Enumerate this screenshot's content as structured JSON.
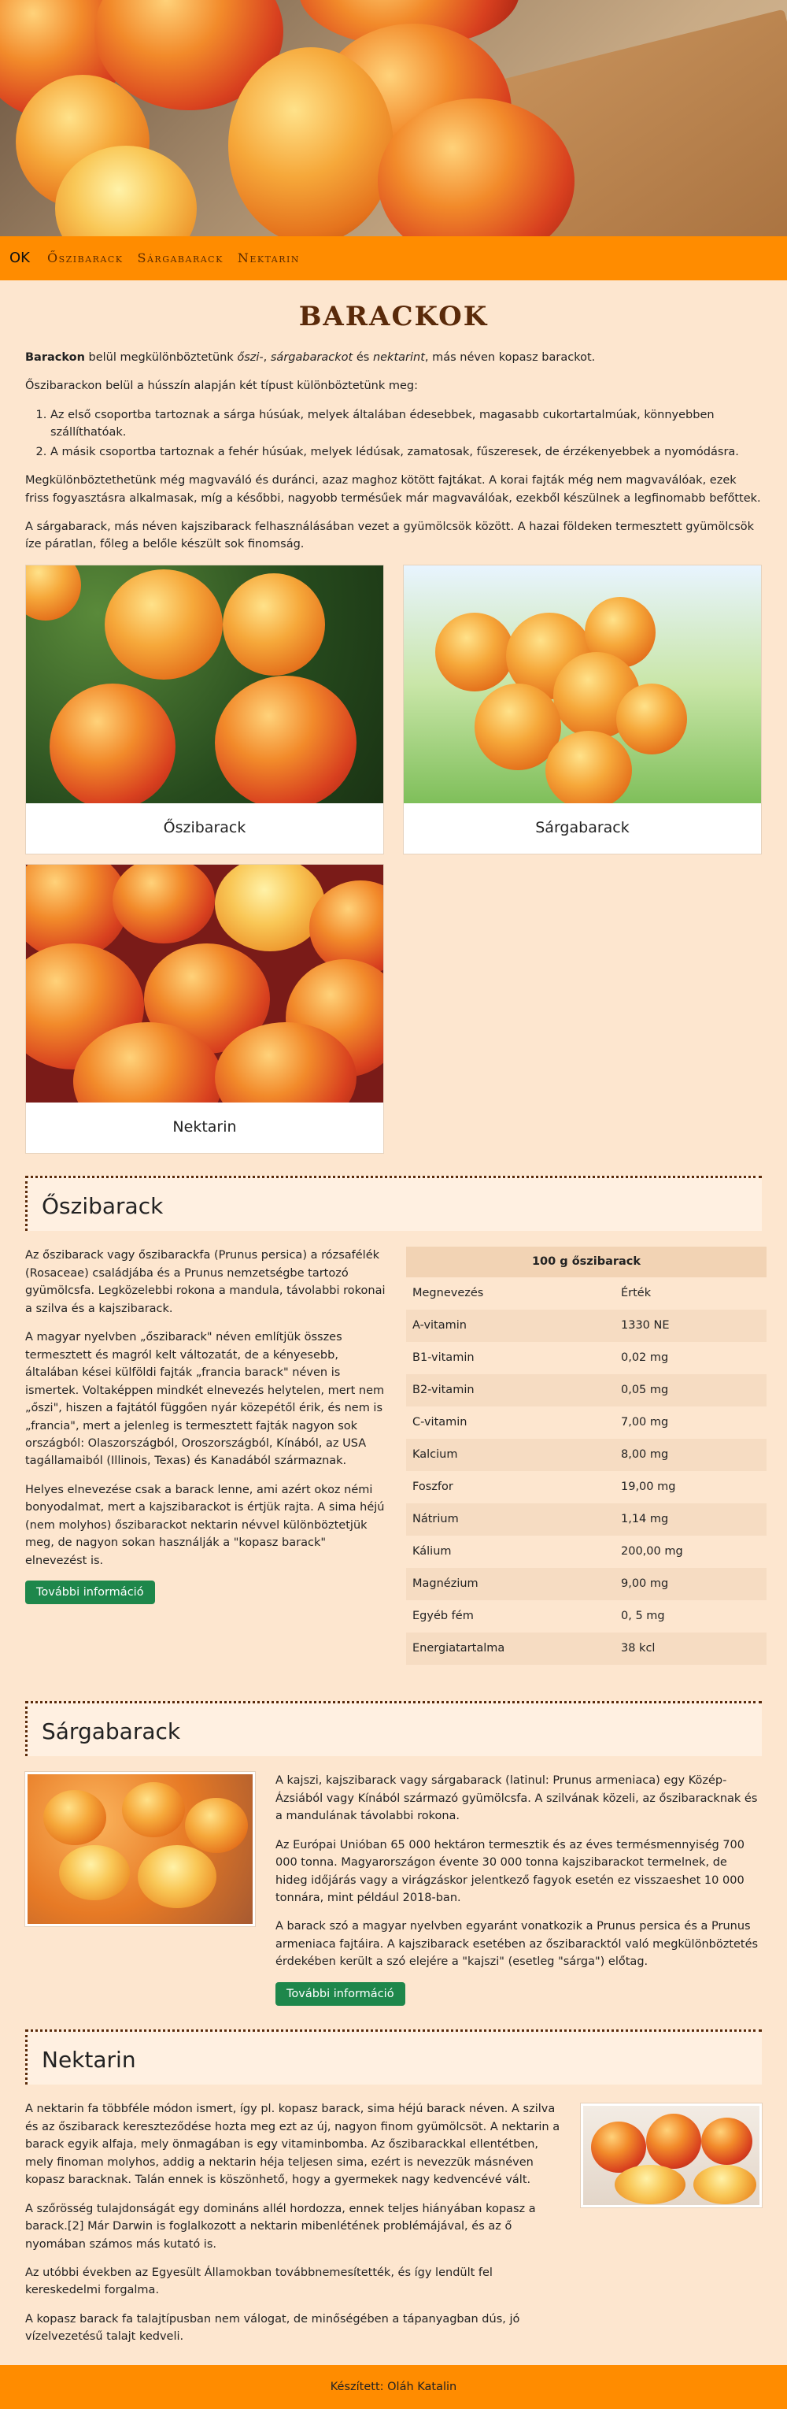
{
  "nav": {
    "brand": "OK",
    "links": [
      "Őszibarack",
      "Sárgabarack",
      "Nektarin"
    ]
  },
  "page_title": "BARACKOK",
  "intro": {
    "p1_bold": "Barackon",
    "p1_a": " belül megkülönböztetünk ",
    "p1_em1": "őszi-",
    "p1_b": ", ",
    "p1_em2": "sárgabarackot",
    "p1_c": " és ",
    "p1_em3": "nektarint",
    "p1_d": ", más néven kopasz barackot.",
    "p2": "Őszibarackon belül a hússzín alapján két típust különböztetünk meg:",
    "list": [
      "Az első csoportba tartoznak a sárga húsúak, melyek általában édesebbek, magasabb cukortartalmúak, könnyebben szállíthatóak.",
      "A másik csoportba tartoznak a fehér húsúak, melyek lédúsak, zamatosak, fűszeresek, de érzékenyebbek a nyomódásra."
    ],
    "p3": "Megkülönböztethetünk még magvaváló és duránci, azaz maghoz kötött fajtákat. A korai fajták még nem magvaválóak, ezek friss fogyasztásra alkalmasak, míg a későbbi, nagyobb termésűek már magvaválóak, ezekből készülnek a legfinomabb befőttek.",
    "p4": "A sárgabarack, más néven kajszibarack felhasználásában vezet a gyümölcsök között. A hazai földeken termesztett gyümölcsök íze páratlan, főleg a belőle készült sok finomság."
  },
  "cards": [
    "Őszibarack",
    "Sárgabarack",
    "Nektarin"
  ],
  "oszi": {
    "title": "Őszibarack",
    "p1": "Az őszibarack vagy őszibarackfa (Prunus persica) a rózsafélék (Rosaceae) családjába és a Prunus nemzetségbe tartozó gyümölcsfa. Legközelebbi rokona a mandula, távolabbi rokonai a szilva és a kajszibarack.",
    "p2": "A magyar nyelvben „őszibarack\" néven említjük összes termesztett és magról kelt változatát, de a kényesebb, általában kései külföldi fajták „francia barack\" néven is ismertek. Voltaképpen mindkét elnevezés helytelen, mert nem „őszi\", hiszen a fajtától függően nyár közepétől érik, és nem is „francia\", mert a jelenleg is termesztett fajták nagyon sok országból: Olaszországból, Oroszországból, Kínából, az USA tagállamaiból (Illinois, Texas) és Kanadából származnak.",
    "p3": "Helyes elnevezése csak a barack lenne, ami azért okoz némi bonyodalmat, mert a kajszibarackot is értjük rajta. A sima héjú (nem molyhos) őszibarackot nektarin névvel különböztetjük meg, de nagyon sokan használják a \"kopasz barack\" elnevezést is.",
    "button": "További információ",
    "table": {
      "caption": "100 g őszibarack",
      "header": [
        "Megnevezés",
        "Érték"
      ],
      "rows": [
        [
          "A-vitamin",
          "1330 NE"
        ],
        [
          "B1-vitamin",
          "0,02 mg"
        ],
        [
          "B2-vitamin",
          "0,05 mg"
        ],
        [
          "C-vitamin",
          "7,00 mg"
        ],
        [
          "Kalcium",
          "8,00 mg"
        ],
        [
          "Foszfor",
          "19,00 mg"
        ],
        [
          "Nátrium",
          "1,14 mg"
        ],
        [
          "Kálium",
          "200,00 mg"
        ],
        [
          "Magnézium",
          "9,00 mg"
        ],
        [
          "Egyéb fém",
          "0, 5 mg"
        ],
        [
          "Energiatartalma",
          "38 kcl"
        ]
      ]
    }
  },
  "sarga": {
    "title": "Sárgabarack",
    "p1": "A kajszi, kajszibarack vagy sárgabarack (latinul: Prunus armeniaca) egy Közép-Ázsiából vagy Kínából származó gyümölcsfa. A szilvának közeli, az őszibaracknak és a mandulának távolabbi rokona.",
    "p2": "Az Európai Unióban 65 000 hektáron termesztik és az éves termésmennyiség 700 000 tonna. Magyarországon évente 30 000 tonna kajszibarackot termelnek, de hideg időjárás vagy a virágzáskor jelentkező fagyok esetén ez visszaeshet 10 000 tonnára, mint például 2018-ban.",
    "p3": "A barack szó a magyar nyelvben egyaránt vonatkozik a Prunus persica és a Prunus armeniaca fajtáira. A kajszibarack esetében az őszibaracktól való megkülönböztetés érdekében került a szó elejére a \"kajszi\" (esetleg \"sárga\") előtag.",
    "button": "További információ"
  },
  "nektarin": {
    "title": "Nektarin",
    "p1": "A nektarin fa többféle módon ismert, így pl. kopasz barack, sima héjú barack néven. A szilva és az őszibarack kereszteződése hozta meg ezt az új, nagyon finom gyümölcsöt. A nektarin a barack egyik alfaja, mely önmagában is egy vitaminbomba. Az őszibarackkal ellentétben, mely finoman molyhos, addig a nektarin héja teljesen sima, ezért is nevezzük másnéven kopasz baracknak. Talán ennek is köszönhető, hogy a gyermekek nagy kedvencévé vált.",
    "p2": "A szőrösség tulajdonságát egy domináns allél hordozza, ennek teljes hiányában kopasz a barack.[2] Már Darwin is foglalkozott a nektarin mibenlétének problémájával, és az ő nyomában számos más kutató is.",
    "p3": "Az utóbbi években az Egyesült Államokban továbbnemesítették, és így lendült fel kereskedelmi forgalma.",
    "p4": "A kopasz barack fa talajtípusban nem válogat, de minőségében a tápanyagban dús, jó vízelvezetésű talajt kedveli."
  },
  "footer": "Készített: Oláh Katalin"
}
